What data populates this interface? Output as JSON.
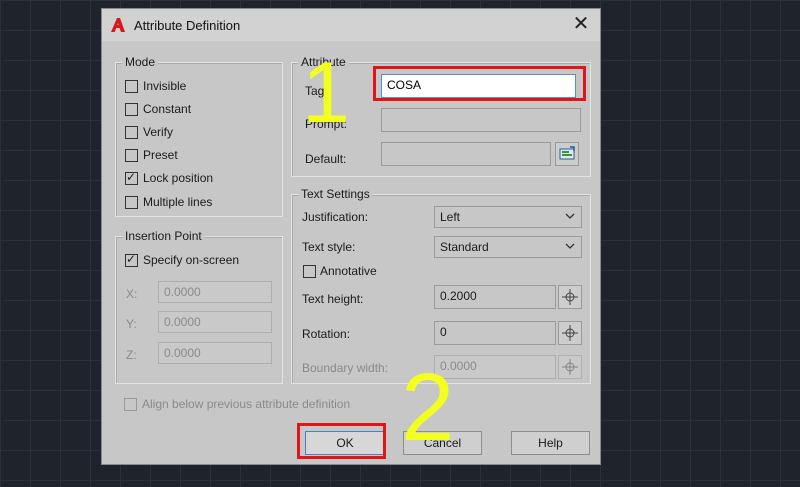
{
  "dialog": {
    "title": "Attribute Definition",
    "close_symbol": "✕",
    "icon": "autocad-icon"
  },
  "mode": {
    "title": "Mode",
    "items": [
      {
        "label": "Invisible",
        "checked": false
      },
      {
        "label": "Constant",
        "checked": false
      },
      {
        "label": "Verify",
        "checked": false
      },
      {
        "label": "Preset",
        "checked": false
      },
      {
        "label": "Lock position",
        "checked": true
      },
      {
        "label": "Multiple lines",
        "checked": false
      }
    ]
  },
  "insertion_point": {
    "title": "Insertion Point",
    "specify_label": "Specify on-screen",
    "specify_checked": true,
    "x_label": "X:",
    "x_value": "0.0000",
    "y_label": "Y:",
    "y_value": "0.0000",
    "z_label": "Z:",
    "z_value": "0.0000"
  },
  "attribute": {
    "title": "Attribute",
    "tag_label": "Tag:",
    "tag_value": "COSA",
    "prompt_label": "Prompt:",
    "prompt_value": "",
    "default_label": "Default:",
    "default_value": ""
  },
  "text_settings": {
    "title": "Text Settings",
    "justification_label": "Justification:",
    "justification_value": "Left",
    "text_style_label": "Text style:",
    "text_style_value": "Standard",
    "annotative_label": "Annotative",
    "annotative_checked": false,
    "text_height_label": "Text height:",
    "text_height_value": "0.2000",
    "rotation_label": "Rotation:",
    "rotation_value": "0",
    "boundary_width_label": "Boundary width:",
    "boundary_width_value": "0.0000"
  },
  "align_below": {
    "label": "Align below previous attribute definition",
    "checked": false
  },
  "buttons": {
    "ok": "OK",
    "cancel": "Cancel",
    "help": "Help"
  },
  "annotations": {
    "step1": "1",
    "step2": "2",
    "highlight_color": "#e0151b",
    "annotation_color": "#f2ff1f"
  }
}
